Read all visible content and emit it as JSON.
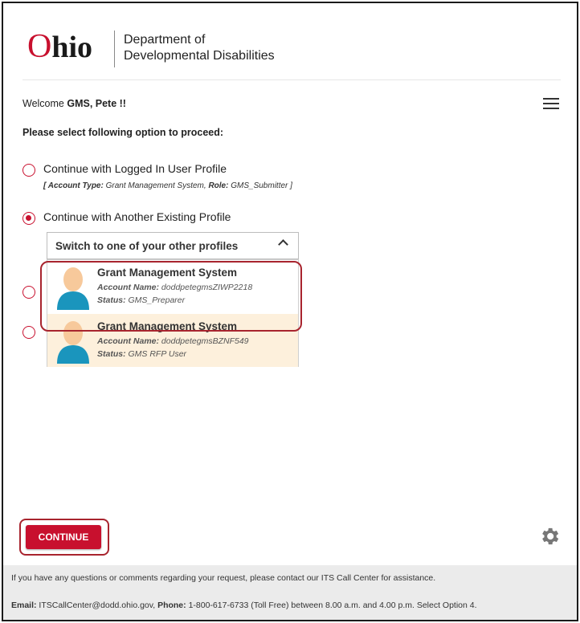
{
  "header": {
    "logo_first": "O",
    "logo_rest": "hio",
    "dept_line1": "Department of",
    "dept_line2": "Developmental Disabilities"
  },
  "welcome": {
    "prefix": "Welcome ",
    "user": "GMS, Pete !!"
  },
  "prompt": "Please select following option to proceed:",
  "options": [
    {
      "label": "Continue with Logged In User Profile",
      "selected": false,
      "sub_open": "[ ",
      "sub_type_label": "Account Type:",
      "sub_type_value": " Grant Management System, ",
      "sub_role_label": "Role:",
      "sub_role_value": " GMS_Submitter ]"
    },
    {
      "label": "Continue with Another Existing Profile",
      "selected": true
    }
  ],
  "dropdown": {
    "label": "Switch to one of your other profiles",
    "icon": "chevron-up-icon"
  },
  "profiles": [
    {
      "name": "Grant Management System",
      "account_label": "Account Name:",
      "account_value": " doddpetegmsZIWP2218",
      "status_label": "Status:",
      "status_value": " GMS_Preparer"
    },
    {
      "name": "Grant Management System",
      "account_label": "Account Name:",
      "account_value": " doddpetegmsBZNF549",
      "status_label": "Status:",
      "status_value": " GMS RFP User"
    }
  ],
  "continue_label": "CONTINUE",
  "footer": {
    "line1": "If you have any questions or comments regarding your request, please contact our ITS Call Center for assistance.",
    "email_label": "Email:",
    "email_value": " ITSCallCenter@dodd.ohio.gov, ",
    "phone_label": "Phone:",
    "phone_value": " 1-800-617-6733 (Toll Free) between 8.00 a.m. and 4.00 p.m. Select Option 4."
  },
  "colors": {
    "accent": "#c8102e",
    "highlight_ring": "#a8242e",
    "selected_profile_bg": "#fdf0dc",
    "footer_bg": "#ebebeb"
  }
}
